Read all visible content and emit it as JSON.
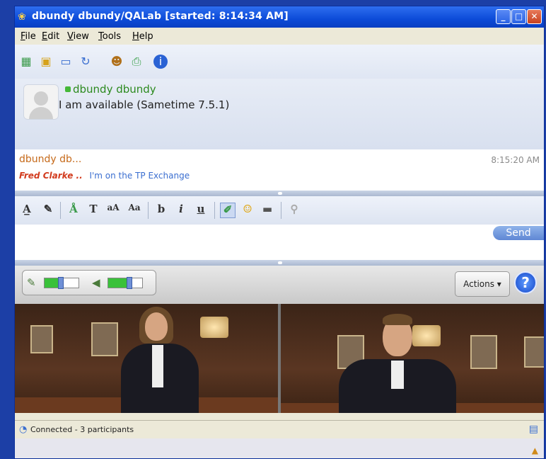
{
  "window": {
    "title": "dbundy dbundy/QALab [started: 8:14:34 AM]",
    "controls": {
      "minimize": "_",
      "maximize": "□",
      "close": "✕"
    }
  },
  "menu": [
    "File",
    "Edit",
    "View",
    "Tools",
    "Help"
  ],
  "toolbar": {
    "icons": [
      "contacts-icon",
      "gift-icon",
      "screen-share-icon",
      "refresh-icon",
      "people-icon",
      "print-icon",
      "info-icon"
    ],
    "info_glyph": "i"
  },
  "profile": {
    "name": "dbundy dbundy",
    "status": "I am available  (Sametime 7.5.1)"
  },
  "transcript": {
    "sender": "dbundy db...",
    "time": "8:15:20 AM",
    "from": "Fred Clarke ..",
    "message": "I'm on the TP Exchange"
  },
  "format_toolbar": {
    "bold": "b",
    "italic": "i",
    "underline": "u",
    "text_glyph": "T"
  },
  "input": {
    "send_label": "Send"
  },
  "av": {
    "actions_label": "Actions ▾",
    "help_glyph": "?",
    "mic_level": 0.45,
    "speaker_level": 0.6
  },
  "status": {
    "text": "Connected - 3 participants"
  },
  "colors": {
    "title_bar": "#0c4bd8",
    "status_online": "#45b838",
    "sender": "#c66a1a",
    "from": "#d23b1e",
    "message": "#3a6ed0"
  }
}
